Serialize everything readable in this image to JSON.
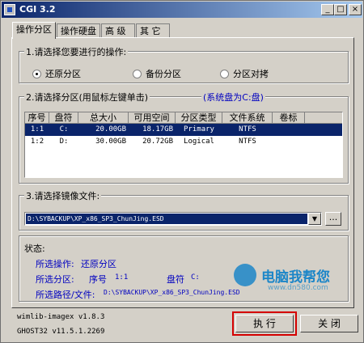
{
  "window": {
    "title": "CGI 3.2",
    "controls": [
      "_",
      "□",
      "×"
    ]
  },
  "tabs": [
    {
      "label": "操作分区",
      "active": true
    },
    {
      "label": "操作硬盘",
      "active": false
    },
    {
      "label": "高 级",
      "active": false
    },
    {
      "label": "其 它",
      "active": false
    }
  ],
  "operation": {
    "legend": "1.请选择您要进行的操作:",
    "options": [
      {
        "label": "还原分区",
        "selected": true
      },
      {
        "label": "备份分区",
        "selected": false
      },
      {
        "label": "分区对拷",
        "selected": false
      }
    ]
  },
  "partition": {
    "legend": "2.请选择分区(用鼠标左键单击)",
    "system_note": "(系统盘为C:盘)",
    "columns": [
      "序号",
      "盘符",
      "总大小",
      "可用空间",
      "分区类型",
      "文件系统",
      "卷标"
    ],
    "rows": [
      {
        "index": "1:1",
        "drive": "C:",
        "total": "20.00GB",
        "free": "18.17GB",
        "type": "Primary",
        "fs": "NTFS",
        "label": "",
        "selected": true
      },
      {
        "index": "1:2",
        "drive": "D:",
        "total": "30.00GB",
        "free": "20.72GB",
        "type": "Logical",
        "fs": "NTFS",
        "label": "",
        "selected": false
      }
    ]
  },
  "image": {
    "legend": "3.请选择镜像文件:",
    "path": "D:\\SYBACKUP\\XP_x86_SP3_ChunJing.ESD",
    "browse_label": "..."
  },
  "status": {
    "title": "状态:",
    "op_label": "所选操作:",
    "op_value": "还原分区",
    "part_label": "所选分区:",
    "seq_label": "序号",
    "seq_value": "1:1",
    "drive_label": "盘符",
    "drive_value": "C:",
    "path_label": "所选路径/文件:",
    "path_value": "D:\\SYBACKUP\\XP_x86_SP3_ChunJing.ESD"
  },
  "footer": {
    "wimlib": "wimlib-imagex v1.8.3",
    "ghost": "GHOST32 v11.5.1.2269",
    "run_label": "执 行",
    "close_label": "关 闭"
  },
  "watermark": {
    "brand": "电脑我帮您",
    "site": "www.dn580.com"
  },
  "colors": {
    "highlight": "#d40000",
    "selection": "#0a246a",
    "status_text": "#0000c0"
  }
}
